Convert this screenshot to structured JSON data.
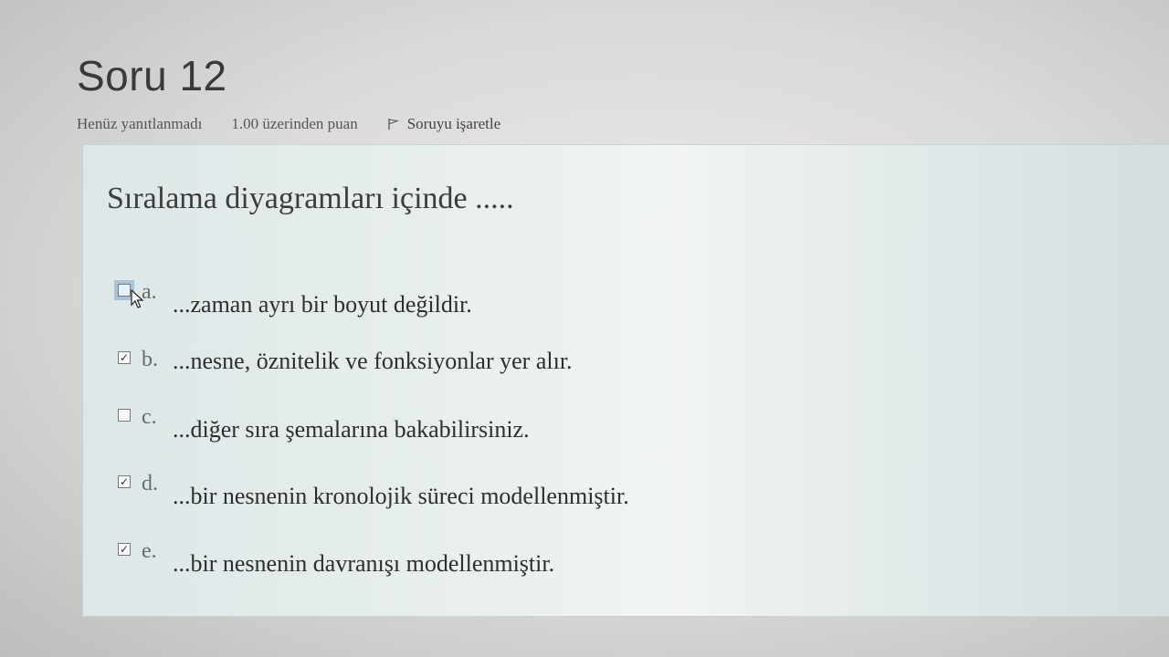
{
  "question": {
    "title": "Soru 12",
    "status": "Henüz yanıtlanmadı",
    "points": "1.00 üzerinden puan",
    "flag_label": "Soruyu işaretle",
    "text": "Sıralama diyagramları içinde ....."
  },
  "answers": [
    {
      "letter": "a.",
      "text": "...zaman ayrı bir boyut değildir.",
      "checked": false
    },
    {
      "letter": "b.",
      "text": "...nesne, öznitelik ve fonksiyonlar yer alır.",
      "checked": true
    },
    {
      "letter": "c.",
      "text": "...diğer sıra şemalarına bakabilirsiniz.",
      "checked": false
    },
    {
      "letter": "d.",
      "text": "...bir nesnenin kronolojik süreci modellenmiştir.",
      "checked": true
    },
    {
      "letter": "e.",
      "text": "...bir nesnenin davranışı modellenmiştir.",
      "checked": true
    }
  ]
}
